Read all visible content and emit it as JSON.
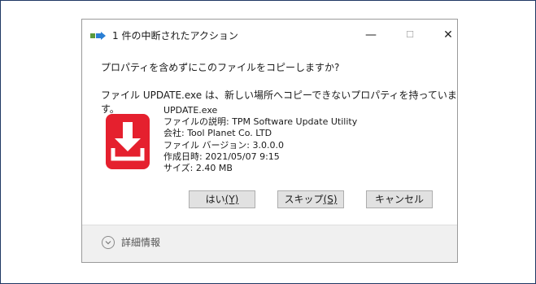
{
  "dialog": {
    "title": "1 件の中断されたアクション",
    "window_buttons": {
      "minimize": "—",
      "maximize": "☐",
      "close": "✕"
    },
    "question": "プロパティを含めずにこのファイルをコピーしますか?",
    "message": "ファイル UPDATE.exe は、新しい場所へコピーできないプロパティを持っています。",
    "file": {
      "name": "UPDATE.exe",
      "description": "ファイルの説明: TPM Software Update Utility",
      "company": "会社: Tool Planet Co. LTD",
      "version": "ファイル バージョン: 3.0.0.0",
      "created": "作成日時: 2021/05/07 9:15",
      "size": "サイズ: 2.40 MB"
    },
    "buttons": {
      "yes_label": "はい",
      "yes_key": "(Y)",
      "skip_label": "スキップ",
      "skip_key": "(S)",
      "cancel_label": "キャンセル"
    },
    "footer": {
      "details_label": "詳細情報"
    }
  },
  "colors": {
    "file_icon_red": "#e5202e",
    "frame_border": "#1f3864"
  }
}
